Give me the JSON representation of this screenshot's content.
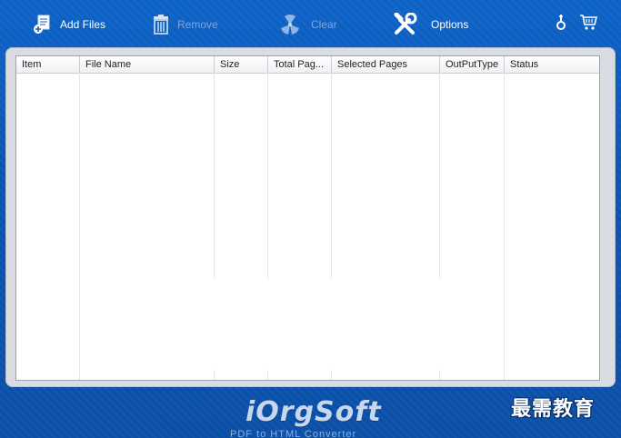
{
  "toolbar": {
    "add_files": {
      "label": "Add Files",
      "icon": "add-files-icon",
      "enabled": true
    },
    "remove": {
      "label": "Remove",
      "icon": "trash-icon",
      "enabled": false
    },
    "clear": {
      "label": "Clear",
      "icon": "clear-icon",
      "enabled": false
    },
    "options": {
      "label": "Options",
      "icon": "tools-icon",
      "enabled": true
    },
    "help": {
      "icon": "help-icon"
    },
    "buy": {
      "icon": "cart-icon"
    }
  },
  "table": {
    "columns": [
      {
        "label": "Item"
      },
      {
        "label": "File Name"
      },
      {
        "label": "Size"
      },
      {
        "label": "Total Pag..."
      },
      {
        "label": "Selected Pages"
      },
      {
        "label": "OutPutType"
      },
      {
        "label": "Status"
      }
    ],
    "rows": []
  },
  "footer": {
    "brand": "iOrgSoft",
    "subtitle": "PDF to HTML Converter"
  },
  "watermark": "最需教育",
  "colors": {
    "background": "#0b57b5",
    "panel": "#d9dde3",
    "disabled_text": "#7fa6d6"
  }
}
